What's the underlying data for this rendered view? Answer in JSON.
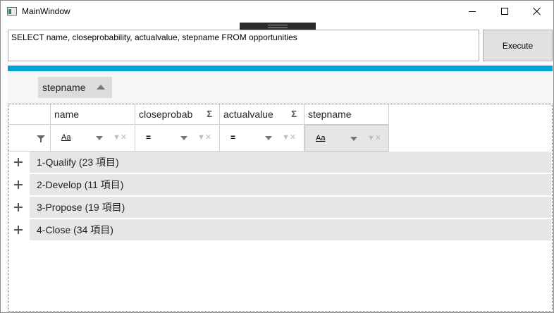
{
  "window": {
    "title": "MainWindow"
  },
  "query": {
    "text": "SELECT name, closeprobability, actualvalue, stepname FROM opportunities"
  },
  "execute": {
    "label": "Execute"
  },
  "group_panel": {
    "chip_label": "stepname",
    "sort_icon": "sort-ascending-icon"
  },
  "columns": [
    {
      "label": "name"
    },
    {
      "label": "closeprobab",
      "summary_icon": "Σ"
    },
    {
      "label": "actualvalue",
      "summary_icon": "Σ"
    },
    {
      "label": "stepname"
    }
  ],
  "filters": [
    {
      "operator": "Aa"
    },
    {
      "operator": "="
    },
    {
      "operator": "="
    },
    {
      "operator": "Aa"
    }
  ],
  "groups": [
    {
      "label": "1-Qualify (23 項目)"
    },
    {
      "label": "2-Develop (11 項目)"
    },
    {
      "label": "3-Propose (19 項目)"
    },
    {
      "label": "4-Close (34 項目)"
    }
  ],
  "colors": {
    "accent": "#00a2d8",
    "group_row": "#e6e6e6"
  }
}
